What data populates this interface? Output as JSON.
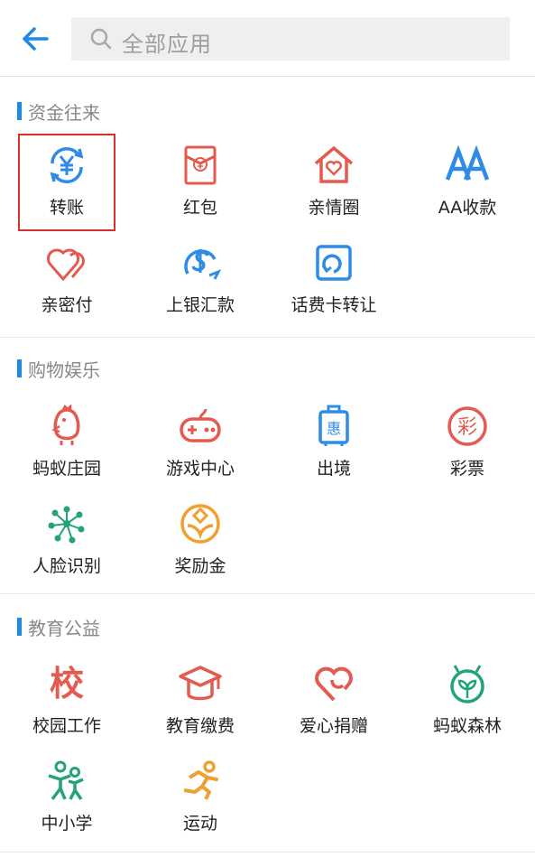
{
  "header": {
    "search_placeholder": "全部应用"
  },
  "sections": [
    {
      "title": "资金往来",
      "items": [
        {
          "label": "转账",
          "icon": "transfer-yuan-icon",
          "color": "#2f8be6"
        },
        {
          "label": "红包",
          "icon": "red-envelope-icon",
          "color": "#e55a4f"
        },
        {
          "label": "亲情圈",
          "icon": "family-house-icon",
          "color": "#e55a4f"
        },
        {
          "label": "AA收款",
          "icon": "aa-icon",
          "color": "#2f8be6"
        },
        {
          "label": "亲密付",
          "icon": "double-heart-icon",
          "color": "#e55a4f"
        },
        {
          "label": "上银汇款",
          "icon": "dollar-remit-icon",
          "color": "#2f8be6"
        },
        {
          "label": "话费卡转让",
          "icon": "card-refresh-icon",
          "color": "#2f8be6"
        }
      ]
    },
    {
      "title": "购物娱乐",
      "items": [
        {
          "label": "蚂蚁庄园",
          "icon": "chick-icon",
          "color": "#e55a4f"
        },
        {
          "label": "游戏中心",
          "icon": "gamepad-icon",
          "color": "#e55a4f"
        },
        {
          "label": "出境",
          "icon": "luggage-icon",
          "color": "#2f8be6"
        },
        {
          "label": "彩票",
          "icon": "lottery-icon",
          "color": "#e55a4f"
        },
        {
          "label": "人脸识别",
          "icon": "face-dots-icon",
          "color": "#22a37a"
        },
        {
          "label": "奖励金",
          "icon": "reward-coin-icon",
          "color": "#f0a030"
        }
      ]
    },
    {
      "title": "教育公益",
      "items": [
        {
          "label": "校园工作",
          "icon": "school-char-icon",
          "color": "#e55a4f",
          "glyph": "校"
        },
        {
          "label": "教育缴费",
          "icon": "graduation-cap-icon",
          "color": "#e55a4f"
        },
        {
          "label": "爱心捐赠",
          "icon": "heart-hand-icon",
          "color": "#e55a4f"
        },
        {
          "label": "蚂蚁森林",
          "icon": "sprout-icon",
          "color": "#22a37a"
        },
        {
          "label": "中小学",
          "icon": "kids-icon",
          "color": "#22a37a"
        },
        {
          "label": "运动",
          "icon": "runner-icon",
          "color": "#f0a030"
        }
      ]
    }
  ]
}
